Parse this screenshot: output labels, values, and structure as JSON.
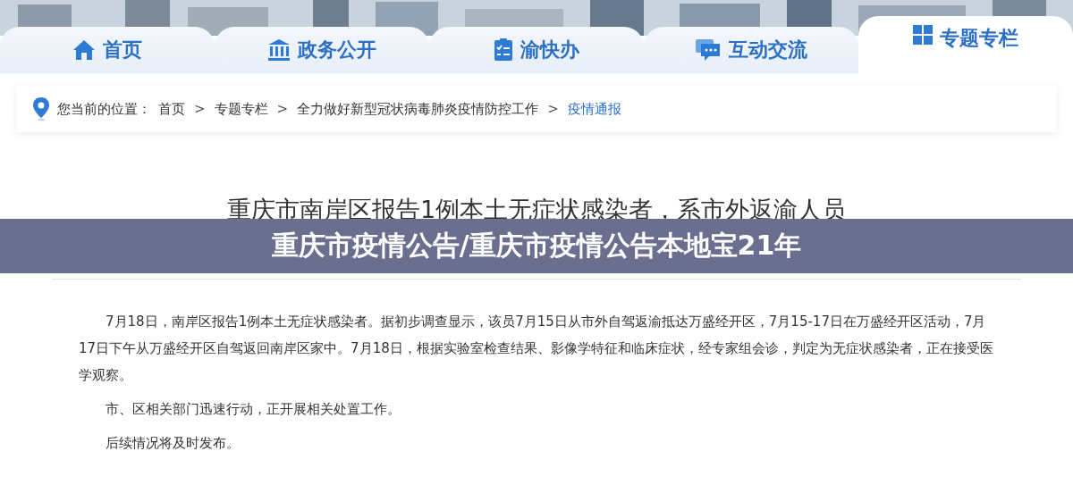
{
  "nav_tabs": [
    {
      "label": "首页",
      "selected": false
    },
    {
      "label": "政务公开",
      "selected": false
    },
    {
      "label": "渝快办",
      "selected": false
    },
    {
      "label": "互动交流",
      "selected": false
    },
    {
      "label": "专题专栏",
      "selected": true
    }
  ],
  "breadcrumb": {
    "prefix": "您当前的位置：",
    "items": [
      {
        "label": "首页",
        "current": false
      },
      {
        "label": "专题专栏",
        "current": false
      },
      {
        "label": "全力做好新型冠状病毒肺炎疫情防控工作",
        "current": false
      },
      {
        "label": "疫情通报",
        "current": true
      }
    ],
    "separator": ">"
  },
  "article": {
    "title": "重庆市南岸区报告1例本土无症状感染者，系市外返渝人员",
    "paragraphs": [
      "7月18日，南岸区报告1例本土无症状感染者。据初步调查显示，该员7月15日从市外自驾返渝抵达万盛经开区，7月15-17日在万盛经开区活动，7月17日下午从万盛经开区自驾返回南岸区家中。7月18日，根据实验室检查结果、影像学特征和临床症状，经专家组会诊，判定为无症状感染者，正在接受医学观察。",
      "市、区相关部门迅速行动，正开展相关处置工作。",
      "后续情况将及时发布。"
    ]
  },
  "banner": {
    "title": "重庆市疫情公告/重庆市疫情公告本地宝21年"
  }
}
